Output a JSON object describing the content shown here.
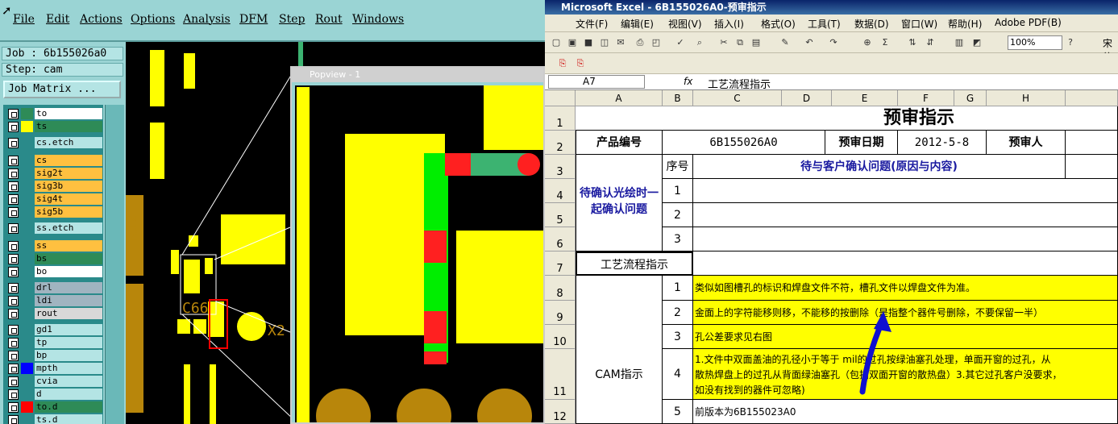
{
  "cam": {
    "menu": [
      "File",
      "Edit",
      "Actions",
      "Options",
      "Analysis",
      "DFM",
      "Step",
      "Rout",
      "Windows"
    ],
    "job_label": "Job : 6b155026a0",
    "step_label": "Step: cam",
    "job_matrix_button": "Job Matrix ...",
    "layers": [
      {
        "name": "to",
        "swatch": "#2e8b57",
        "bg": "#ffffff"
      },
      {
        "name": "ts",
        "swatch": "#ffff00",
        "bg": "#2e8b57"
      },
      {
        "name": "cs.etch",
        "swatch": "",
        "bg": "#b4e4e4"
      },
      {
        "name": "cs",
        "swatch": "",
        "bg": "#ffc040"
      },
      {
        "name": "sig2t",
        "swatch": "",
        "bg": "#ffc040"
      },
      {
        "name": "sig3b",
        "swatch": "",
        "bg": "#ffc040"
      },
      {
        "name": "sig4t",
        "swatch": "",
        "bg": "#ffc040"
      },
      {
        "name": "sig5b",
        "swatch": "",
        "bg": "#ffc040"
      },
      {
        "name": "ss.etch",
        "swatch": "",
        "bg": "#b4e4e4"
      },
      {
        "name": "ss",
        "swatch": "",
        "bg": "#ffc040"
      },
      {
        "name": "bs",
        "swatch": "",
        "bg": "#2e8b57"
      },
      {
        "name": "bo",
        "swatch": "",
        "bg": "#ffffff"
      },
      {
        "name": "drl",
        "swatch": "",
        "bg": "#a0b4c0"
      },
      {
        "name": "ldi",
        "swatch": "",
        "bg": "#a0b4c0"
      },
      {
        "name": "rout",
        "swatch": "",
        "bg": "#d8d8d8"
      },
      {
        "name": "gd1",
        "swatch": "",
        "bg": "#b4e4e4"
      },
      {
        "name": "tp",
        "swatch": "",
        "bg": "#b4e4e4"
      },
      {
        "name": "bp",
        "swatch": "",
        "bg": "#b4e4e4"
      },
      {
        "name": "mpth",
        "swatch": "#0000ff",
        "bg": "#b4e4e4"
      },
      {
        "name": "cvia",
        "swatch": "",
        "bg": "#b4e4e4"
      },
      {
        "name": "d",
        "swatch": "",
        "bg": "#b4e4e4"
      },
      {
        "name": "to.d",
        "swatch": "#ff0000",
        "bg": "#2e8b57"
      },
      {
        "name": "ts.d",
        "swatch": "",
        "bg": "#b4e4e4"
      }
    ],
    "popview_title": "Popview - 1"
  },
  "excel": {
    "title": "Microsoft Excel - 6B155026A0-预审指示",
    "menu": [
      "文件(F)",
      "编辑(E)",
      "视图(V)",
      "插入(I)",
      "格式(O)",
      "工具(T)",
      "数据(D)",
      "窗口(W)",
      "帮助(H)",
      "Adobe PDF(B)"
    ],
    "zoom": "100%",
    "font": "宋体",
    "name_box": "A7",
    "fx": "fx",
    "formula": "工艺流程指示",
    "columns": [
      "A",
      "B",
      "C",
      "D",
      "E",
      "F",
      "G",
      "H"
    ],
    "rows": [
      "1",
      "2",
      "3",
      "4",
      "5",
      "6",
      "7",
      "8",
      "9",
      "10",
      "11",
      "12"
    ],
    "cells": {
      "title": "预审指示",
      "product_no_label": "产品编号",
      "product_no": "6B155026A0",
      "review_date_label": "预审日期",
      "review_date": "2012-5-8",
      "reviewer_label": "预审人",
      "pending_label": "待确认光绘时一起确认问题",
      "seq_label": "序号",
      "confirm_header": "待与客户确认问题(原因与内容)",
      "n1": "1",
      "n2": "2",
      "n3": "3",
      "process_label": "工艺流程指示",
      "cam_label": "CAM指示",
      "i1": "1",
      "i1_text": "类似如图槽孔的标识和焊盘文件不符，槽孔文件以焊盘文件为准。",
      "i2": "2",
      "i2_text": "金面上的字符能移则移，不能移的按删除（是指整个器件号删除，不要保留一半）",
      "i3": "3",
      "i3_text": "孔公差要求见右图",
      "i4": "4",
      "i4_text_1": "1.文件中双面盖油的孔径小于等于 mil的过孔按绿油塞孔处理，单面开窗的过孔，从",
      "i4_text_2": "散热焊盘上的过孔从背面绿油塞孔（包括双面开窗的散热盘）3.其它过孔客户没要求，",
      "i4_text_3": "如没有找到的器件可忽略)",
      "i5": "5",
      "i5_text": "前版本为6B155023A0"
    }
  }
}
